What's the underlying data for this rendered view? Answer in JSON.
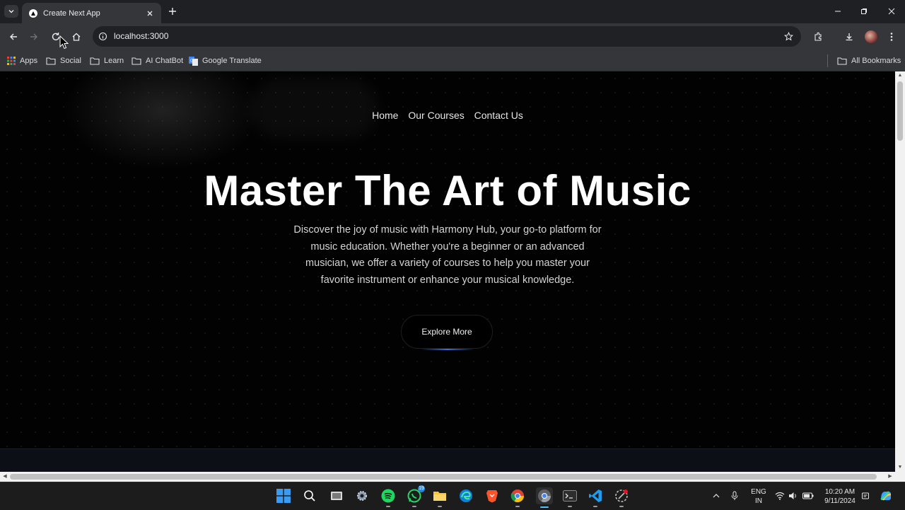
{
  "browser": {
    "tab_title": "Create Next App",
    "url": "localhost:3000",
    "bookmarks": [
      {
        "label": "Apps",
        "icon": "apps-grid-icon"
      },
      {
        "label": "Social",
        "icon": "folder-icon"
      },
      {
        "label": "Learn",
        "icon": "folder-icon"
      },
      {
        "label": "AI ChatBot",
        "icon": "folder-icon"
      },
      {
        "label": "Google Translate",
        "icon": "google-translate-icon"
      }
    ],
    "all_bookmarks": "All Bookmarks"
  },
  "page": {
    "nav": [
      "Home",
      "Our Courses",
      "Contact Us"
    ],
    "hero_title": "Master The Art of Music",
    "hero_description": "Discover the joy of music with Harmony Hub, your go-to platform for music education. Whether you're a beginner or an advanced musician, we offer a variety of courses to help you master your favorite instrument or enhance your musical knowledge.",
    "cta_label": "Explore More"
  },
  "taskbar": {
    "apps": [
      "windows-start-icon",
      "search-icon",
      "task-view-icon",
      "settings-icon",
      "spotify-icon",
      "whatsapp-icon",
      "file-explorer-icon",
      "edge-icon",
      "brave-icon",
      "chrome-icon",
      "chrome-dev-icon",
      "terminal-icon",
      "vscode-icon",
      "snipping-tool-icon"
    ],
    "whatsapp_badge": "19",
    "language": "ENG",
    "region": "IN",
    "time": "10:20 AM",
    "date": "9/11/2024"
  },
  "colors": {
    "page_bg": "#020203",
    "accent_underline": "#3b6fd4",
    "chrome_toolbar": "#35363a"
  }
}
